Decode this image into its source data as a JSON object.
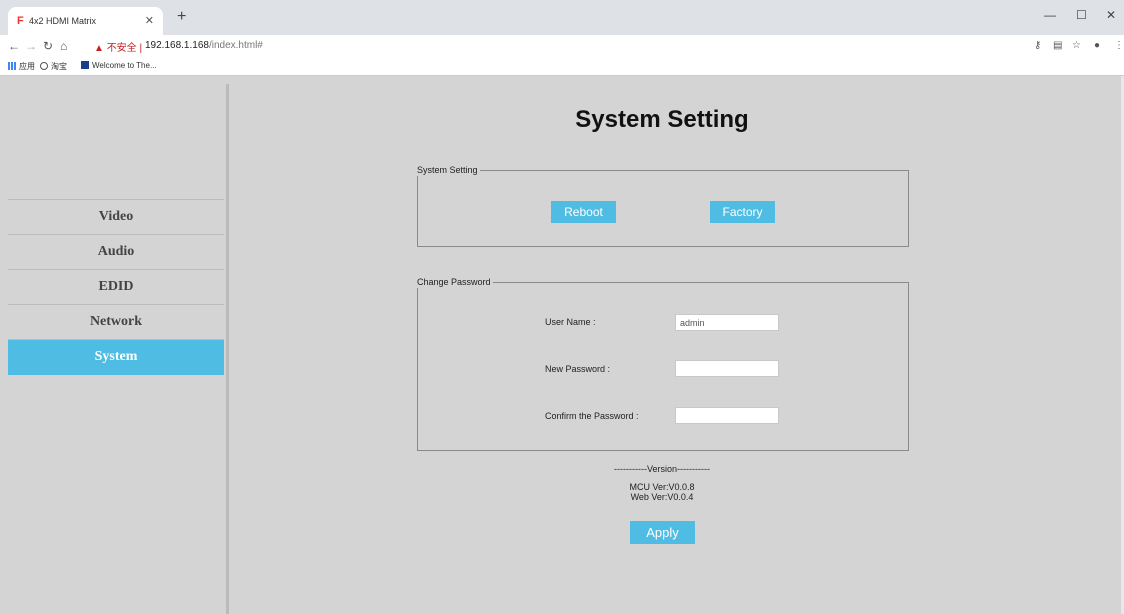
{
  "browser": {
    "tab_title": "4x2 HDMI Matrix",
    "tab_favicon": "F",
    "new_tab": "+",
    "security_warning": "不安全",
    "url_host": "192.168.1.168",
    "url_path": "/index.html#",
    "bookmarks": [
      "应用",
      "淘宝",
      "Welcome to The..."
    ]
  },
  "sidebar": {
    "items": [
      {
        "label": "Video",
        "active": false
      },
      {
        "label": "Audio",
        "active": false
      },
      {
        "label": "EDID",
        "active": false
      },
      {
        "label": "Network",
        "active": false
      },
      {
        "label": "System",
        "active": true
      }
    ]
  },
  "main": {
    "title": "System Setting",
    "system_setting": {
      "legend": "System Setting",
      "reboot_label": "Reboot",
      "factory_label": "Factory"
    },
    "change_password": {
      "legend": "Change Password",
      "username_label": "User Name :",
      "username_value": "admin",
      "new_password_label": "New Password :",
      "new_password_value": "",
      "confirm_password_label": "Confirm the Password :",
      "confirm_password_value": ""
    },
    "version": {
      "header": "-----------Version-----------",
      "mcu": "MCU Ver:V0.0.8",
      "web": "Web Ver:V0.0.4"
    },
    "apply_label": "Apply"
  },
  "colors": {
    "accent": "#4fbde3",
    "background": "#d4d4d4"
  }
}
